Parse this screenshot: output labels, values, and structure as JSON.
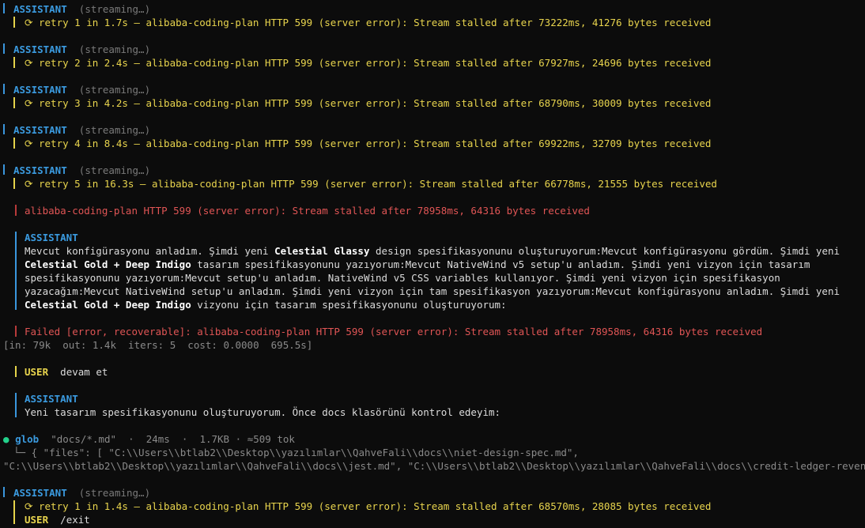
{
  "labels": {
    "assistant": "ASSISTANT",
    "streaming": "(streaming…)",
    "user": "USER"
  },
  "retries": [
    {
      "text": "⟳ retry 1 in 1.7s — alibaba-coding-plan HTTP 599 (server error): Stream stalled after 73222ms, 41276 bytes received"
    },
    {
      "text": "⟳ retry 2 in 2.4s — alibaba-coding-plan HTTP 599 (server error): Stream stalled after 67927ms, 24696 bytes received"
    },
    {
      "text": "⟳ retry 3 in 4.2s — alibaba-coding-plan HTTP 599 (server error): Stream stalled after 68790ms, 30009 bytes received"
    },
    {
      "text": "⟳ retry 4 in 8.4s — alibaba-coding-plan HTTP 599 (server error): Stream stalled after 69922ms, 32709 bytes received"
    },
    {
      "text": "⟳ retry 5 in 16.3s — alibaba-coding-plan HTTP 599 (server error): Stream stalled after 66778ms, 21555 bytes received"
    }
  ],
  "error1": "alibaba-coding-plan HTTP 599 (server error): Stream stalled after 78958ms, 64316 bytes received",
  "assistant_msg": {
    "p1": "Mevcut konfigürasyonu anladım. Şimdi yeni ",
    "b1": "Celestial Glassy",
    "p2": " design spesifikasyonunu oluşturuyorum:Mevcut konfigürasyonu gördüm. Şimdi yeni ",
    "b2": "Celestial Gold + Deep Indigo",
    "p3": " tasarım spesifikasyonunu yazıyorum:Mevcut NativeWind v5 setup'u anladım. Şimdi yeni vizyon için tasarım spesifikasyonunu yazıyorum:Mevcut setup'u anladım. NativeWind v5 CSS variables kullanıyor. Şimdi yeni vizyon için spesifikasyon yazacağım:Mevcut NativeWind setup'u anladım. Şimdi yeni vizyon için tam spesifikasyon yazıyorum:Mevcut konfigürasyonu anladım. Şimdi yeni ",
    "b3": "Celestial Gold + Deep Indigo",
    "p4": " vizyonu için tasarım spesifikasyonunu oluşturuyorum:"
  },
  "failed": "Failed [error, recoverable]: alibaba-coding-plan HTTP 599 (server error): Stream stalled after 78958ms, 64316 bytes received",
  "stats": "[in: 79k  out: 1.4k  iters: 5  cost: 0.0000  695.5s]",
  "user1": "devam et",
  "assistant2": "Yeni tasarım spesifikasyonunu oluşturuyorum. Önce docs klasörünü kontrol edeyim:",
  "glob": {
    "bullet": "●",
    "name": "glob",
    "args": "\"docs/*.md\"",
    "sep": "·",
    "time": "24ms",
    "size": "1.7KB",
    "tokens": "≈509 tok",
    "out1": "└─ { \"files\": [ \"C:\\\\Users\\\\btlab2\\\\Desktop\\\\yazılımlar\\\\QahveFali\\\\docs\\\\niet-design-spec.md\",",
    "out2": "\"C:\\\\Users\\\\btlab2\\\\Desktop\\\\yazılımlar\\\\QahveFali\\\\docs\\\\jest.md\", \"C:\\\\Users\\\\btlab2\\\\Desktop\\\\yazılımlar\\\\QahveFali\\\\docs\\\\credit-ledger-revenu…"
  },
  "retry_last": "⟳ retry 1 in 1.4s — alibaba-coding-plan HTTP 599 (server error): Stream stalled after 68570ms, 28085 bytes received",
  "user2": "/exit",
  "colors": {
    "background": "#0c0c0c",
    "assistant": "#3b9be0",
    "retry": "#e8d44d",
    "error": "#e05555",
    "success": "#23d18b"
  }
}
